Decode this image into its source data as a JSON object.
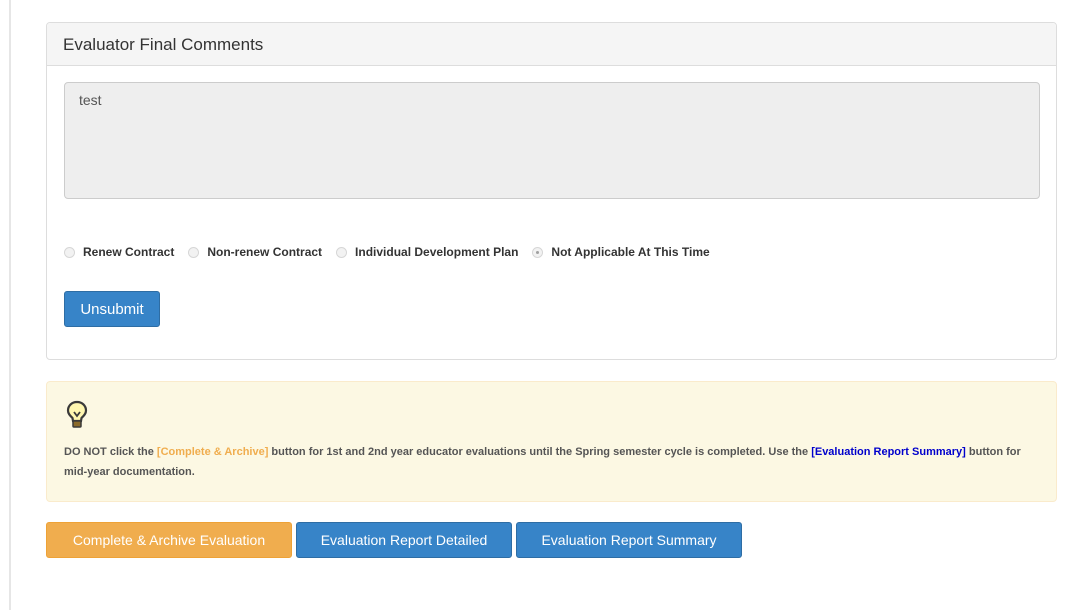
{
  "panel": {
    "title": "Evaluator Final Comments",
    "comment_value": "test",
    "radio_options": [
      {
        "label": "Renew Contract",
        "checked": false
      },
      {
        "label": "Non-renew Contract",
        "checked": false
      },
      {
        "label": "Individual Development Plan",
        "checked": false
      },
      {
        "label": "Not Applicable At This Time",
        "checked": true
      }
    ],
    "unsubmit_label": "Unsubmit"
  },
  "alert": {
    "icon": "lightbulb-icon",
    "text_1": "DO NOT click the ",
    "complete_ref": "[Complete & Archive]",
    "text_2": " button for 1st and 2nd year educator evaluations until the Spring semester cycle is completed. Use the ",
    "summary_ref": "[Evaluation Report Summary]",
    "text_3": " button for mid-year documentation."
  },
  "actions": {
    "complete_label": "Complete & Archive Evaluation",
    "detailed_label": "Evaluation Report Detailed",
    "summary_label": "Evaluation Report Summary"
  },
  "colors": {
    "primary": "#3784c8",
    "warning": "#f0ad4e",
    "alert_bg": "#fcf8e3",
    "link_blue": "#0000cc"
  }
}
